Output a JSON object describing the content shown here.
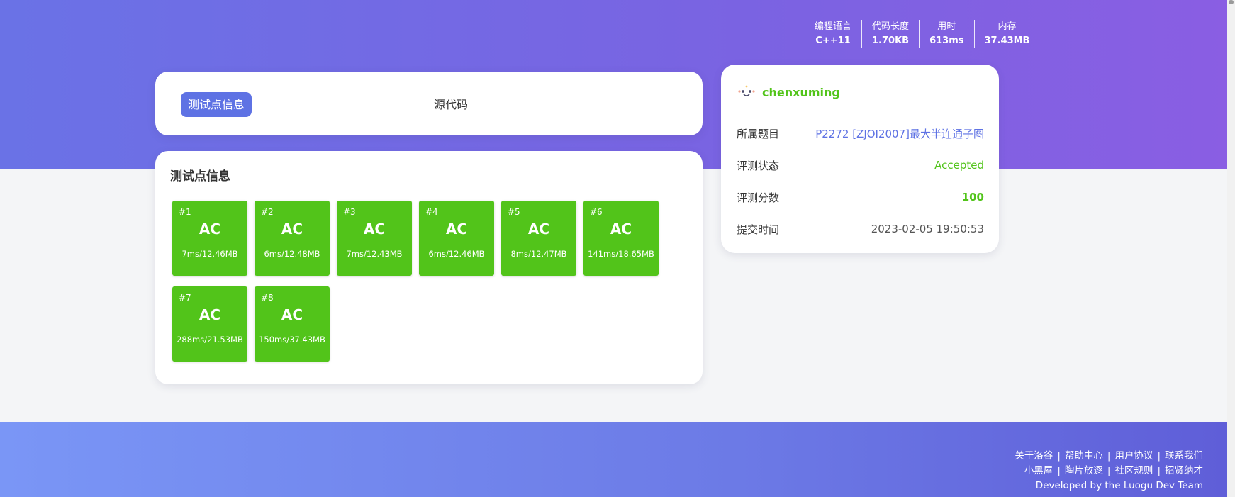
{
  "stats": [
    {
      "label": "编程语言",
      "value": "C++11"
    },
    {
      "label": "代码长度",
      "value": "1.70KB"
    },
    {
      "label": "用时",
      "value": "613ms"
    },
    {
      "label": "内存",
      "value": "37.43MB"
    }
  ],
  "tabs": {
    "active": "测试点信息",
    "source": "源代码"
  },
  "tests": {
    "title": "测试点信息",
    "cases": [
      {
        "id": "#1",
        "result": "AC",
        "info": "7ms/12.46MB"
      },
      {
        "id": "#2",
        "result": "AC",
        "info": "6ms/12.48MB"
      },
      {
        "id": "#3",
        "result": "AC",
        "info": "7ms/12.43MB"
      },
      {
        "id": "#4",
        "result": "AC",
        "info": "6ms/12.46MB"
      },
      {
        "id": "#5",
        "result": "AC",
        "info": "8ms/12.47MB"
      },
      {
        "id": "#6",
        "result": "AC",
        "info": "141ms/18.65MB"
      },
      {
        "id": "#7",
        "result": "AC",
        "info": "288ms/21.53MB"
      },
      {
        "id": "#8",
        "result": "AC",
        "info": "150ms/37.43MB"
      }
    ]
  },
  "info": {
    "username": "chenxuming",
    "rows": [
      {
        "key": "所属题目",
        "value": "P2272 [ZJOI2007]最大半连通子图"
      },
      {
        "key": "评测状态",
        "value": "Accepted"
      },
      {
        "key": "评测分数",
        "value": "100"
      },
      {
        "key": "提交时间",
        "value": "2023-02-05 19:50:53"
      }
    ]
  },
  "footer": {
    "line1": [
      "关于洛谷",
      "帮助中心",
      "用户协议",
      "联系我们"
    ],
    "line2": [
      "小黑屋",
      "陶片放逐",
      "社区规则",
      "招贤纳才"
    ],
    "credit": "Developed by the Luogu Dev Team"
  },
  "colors": {
    "accent": "#5e72e4",
    "accepted": "#52c41a"
  }
}
